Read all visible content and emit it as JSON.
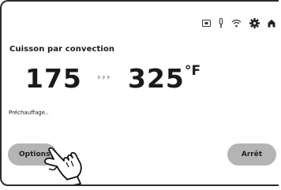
{
  "status_bar": {
    "icons": [
      "camera-icon",
      "probe-icon",
      "wifi-icon",
      "settings-gear-icon",
      "home-icon"
    ]
  },
  "cooking": {
    "mode": "Cuisson par convection",
    "current_temp": "175",
    "target_temp": "325",
    "unit": "°F",
    "status": "Préchauffage.."
  },
  "buttons": {
    "options": "Options",
    "stop": "Arrêt"
  },
  "colors": {
    "button_bg": "#b4b4b4",
    "arrow": "#b9b9b9",
    "text": "#1a1a1a"
  }
}
